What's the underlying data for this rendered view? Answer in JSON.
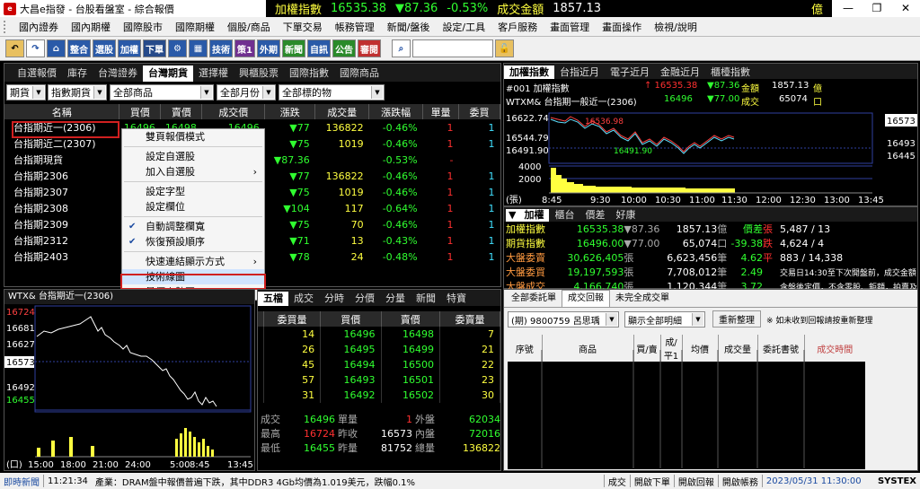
{
  "window": {
    "title": "大昌e指發 - 台股看盤室 - 綜合報價",
    "ticker_label": "加權指數",
    "ticker_price": "16535.38",
    "ticker_change": "▼87.36",
    "ticker_pct": "-0.53%",
    "ticker_amount_label": "成交金額",
    "ticker_amount": "1857.13",
    "ticker_unit": "億",
    "controls": [
      "—",
      "❐",
      "✕"
    ]
  },
  "menu": [
    "國內證券",
    "國內期權",
    "國際股市",
    "國際期權",
    "個股/商品",
    "下單交易",
    "帳務管理",
    "新聞/盤後",
    "設定/工具",
    "客戶服務",
    "畫面管理",
    "畫面操作",
    "檢視/說明"
  ],
  "toolbar": [
    "整合",
    "選股",
    "加權",
    "下單",
    "技術",
    "策1",
    "外期",
    "新聞",
    "自訊",
    "公告",
    "審閱"
  ],
  "quote_panel": {
    "tabs": [
      "自選報價",
      "庫存",
      "台灣證券",
      "台灣期貨",
      "選擇權",
      "興櫃股票",
      "國際指數",
      "國際商品"
    ],
    "active_tab": "台灣期貨",
    "filters": [
      "期貨",
      "指數期貨",
      "全部商品",
      "全部月份",
      "全部標的物"
    ],
    "headers": [
      "名稱",
      "買價",
      "賣價",
      "成交價",
      "漲跌",
      "成交量",
      "漲跌幅",
      "單量",
      "委買"
    ],
    "rows": [
      {
        "name": "台指期近一(2306)",
        "bid": "16496",
        "ask": "16498",
        "last": "16496",
        "chg": "▼77",
        "vol": "136822",
        "pct": "-0.46%",
        "qty": "1",
        "buy": "1"
      },
      {
        "name": "台指期近二(2307)",
        "bid": "",
        "ask": "",
        "last": "",
        "chg": "▼75",
        "vol": "1019",
        "pct": "-0.46%",
        "qty": "1",
        "buy": "1"
      },
      {
        "name": "台指期現貨",
        "bid": "",
        "ask": "",
        "last": "",
        "chg": "▼87.36",
        "vol": "",
        "pct": "-0.53%",
        "qty": "-",
        "buy": ""
      },
      {
        "name": "台指期2306",
        "bid": "",
        "ask": "",
        "last": "96",
        "chg": "▼77",
        "vol": "136822",
        "pct": "-0.46%",
        "qty": "1",
        "buy": "1"
      },
      {
        "name": "台指期2307",
        "bid": "",
        "ask": "",
        "last": "96",
        "chg": "▼75",
        "vol": "1019",
        "pct": "-0.46%",
        "qty": "1",
        "buy": "1"
      },
      {
        "name": "台指期2308",
        "bid": "",
        "ask": "",
        "last": "94",
        "chg": "▼104",
        "vol": "117",
        "pct": "-0.64%",
        "qty": "1",
        "buy": "1"
      },
      {
        "name": "台指期2309",
        "bid": "",
        "ask": "",
        "last": "14",
        "chg": "▼75",
        "vol": "70",
        "pct": "-0.46%",
        "qty": "1",
        "buy": "1"
      },
      {
        "name": "台指期2312",
        "bid": "",
        "ask": "",
        "last": "69",
        "chg": "▼71",
        "vol": "13",
        "pct": "-0.43%",
        "qty": "1",
        "buy": "1"
      },
      {
        "name": "台指期2403",
        "bid": "",
        "ask": "",
        "last": "22",
        "chg": "▼78",
        "vol": "24",
        "pct": "-0.48%",
        "qty": "1",
        "buy": "1"
      }
    ]
  },
  "context_menu": {
    "items": [
      "雙頁報價模式",
      "設定自選股",
      "加入自選股",
      "設定字型",
      "設定欄位",
      "自動調整欄寬",
      "恢復預設順序",
      "快速連結顯示方式",
      "技術線圖",
      "量價走勢圖"
    ]
  },
  "index_panel": {
    "tabs": [
      "加權指數",
      "台指近月",
      "電子近月",
      "金融近月",
      "櫃檯指數"
    ],
    "line1": {
      "code": "#001 加權指數",
      "price": "↑ 16535.38",
      "chg": "▼87.36",
      "amt_label": "金額",
      "amt": "1857.13",
      "unit": "億"
    },
    "line2": {
      "code": "WTXM& 台指期一般近一(2306)",
      "price": "16496",
      "chg": "▼77.00",
      "vol_label": "成交",
      "vol": "65074",
      "unit": "口"
    },
    "left_axis": [
      "16622.74",
      "16544.79",
      "16491.90",
      "4000",
      "2000"
    ],
    "right_axis": [
      "16573",
      "16493",
      "16445"
    ],
    "time_axis": [
      "8:45",
      "9:30",
      "10:00",
      "10:30",
      "11:00",
      "11:30",
      "12:00",
      "12:30",
      "13:00",
      "13:45"
    ],
    "unit": "(張)",
    "annot_high": "16536.98",
    "annot_low": "16491.90"
  },
  "stats_panel": {
    "tabs": [
      "加權",
      "櫃台",
      "價差",
      "好康"
    ],
    "rows": [
      {
        "a": "加權指數",
        "b": "16535.38",
        "c": "▼87.36",
        "d": "1857.13",
        "e": "億",
        "f": "價差",
        "g": "張",
        "h": "5,487 / 13"
      },
      {
        "a": "期貨指數",
        "b": "16496.00",
        "c": "▼77.00",
        "d": "65,074",
        "e": "口",
        "f": "-39.38",
        "g": "跌",
        "h": "4,624 / 4"
      },
      {
        "a": "大盤委賣",
        "b": "30,626,405",
        "c": "張",
        "d": "6,623,456",
        "e": "筆",
        "f": "4.62",
        "g": "平",
        "h": "883 / 14,338"
      },
      {
        "a": "大盤委買",
        "b": "19,197,593",
        "c": "張",
        "d": "7,708,012",
        "e": "筆",
        "f": "2.49",
        "g": "",
        "h": "交易日14:30至下次開盤前，成交金額"
      },
      {
        "a": "大盤成交",
        "b": "4,166,740",
        "c": "張",
        "d": "1,120,344",
        "e": "筆",
        "f": "3.72",
        "g": "",
        "h": "含盤後定價，不含零股、鉅額，拍賣及"
      }
    ]
  },
  "mini_chart": {
    "title": "WTX& 台指期近一(2306)",
    "left_axis": [
      "16724",
      "16681",
      "16627",
      "16573",
      "16492",
      "16455"
    ],
    "time_axis": [
      "(口)",
      "15:00",
      "18:00",
      "21:00",
      "24:00",
      "5:00",
      "8:45",
      "13:45"
    ]
  },
  "order_book": {
    "tabs": [
      "五檔",
      "成交",
      "分時",
      "分價",
      "分量",
      "新聞",
      "特寶"
    ],
    "headers": [
      "委買量",
      "買價",
      "賣價",
      "委賣量"
    ],
    "rows": [
      [
        "14",
        "16496",
        "16498",
        "7"
      ],
      [
        "26",
        "16495",
        "16499",
        "21"
      ],
      [
        "45",
        "16494",
        "16500",
        "22"
      ],
      [
        "57",
        "16493",
        "16501",
        "23"
      ],
      [
        "31",
        "16492",
        "16502",
        "30"
      ]
    ],
    "summary": [
      {
        "k1": "成交",
        "v1": "16496",
        "k2": "單量",
        "v2": "1",
        "k3": "外盤",
        "v3": "62034"
      },
      {
        "k1": "最高",
        "v1": "16724",
        "k2": "昨收",
        "v2": "16573",
        "k3": "內盤",
        "v3": "72016"
      },
      {
        "k1": "最低",
        "v1": "16455",
        "k2": "昨量",
        "v2": "81752",
        "k3": "總量",
        "v3": "136822"
      }
    ]
  },
  "order_panel": {
    "tabs": [
      "全部委託單",
      "成交回報",
      "未完全成交單"
    ],
    "account": "(期) 9800759 呂思瑀",
    "filter": "顯示全部明細",
    "refresh": "重新整理",
    "note": "※ 如未收到回報請按重新整理",
    "headers": [
      "序號",
      "商品",
      "買/賣",
      "成/平1",
      "均價",
      "成交量",
      "委託書號",
      "成交時間"
    ]
  },
  "status": {
    "news_label": "即時新聞",
    "news_time": "11:21:34",
    "news_text": "產業：DRAM盤中報價普遍下跌，其中DDR3 4Gb均價為1.019美元，跌幅0.1%",
    "items": [
      "成交",
      "開啟下單",
      "開啟回報",
      "開啟帳務"
    ],
    "datetime": "2023/05/31 11:30:00",
    "brand": "SYSTEX"
  },
  "colors": {
    "up": "#ff3030",
    "down": "#30ff30",
    "accent": "#ffff40",
    "highlight_red": "#d02020"
  }
}
